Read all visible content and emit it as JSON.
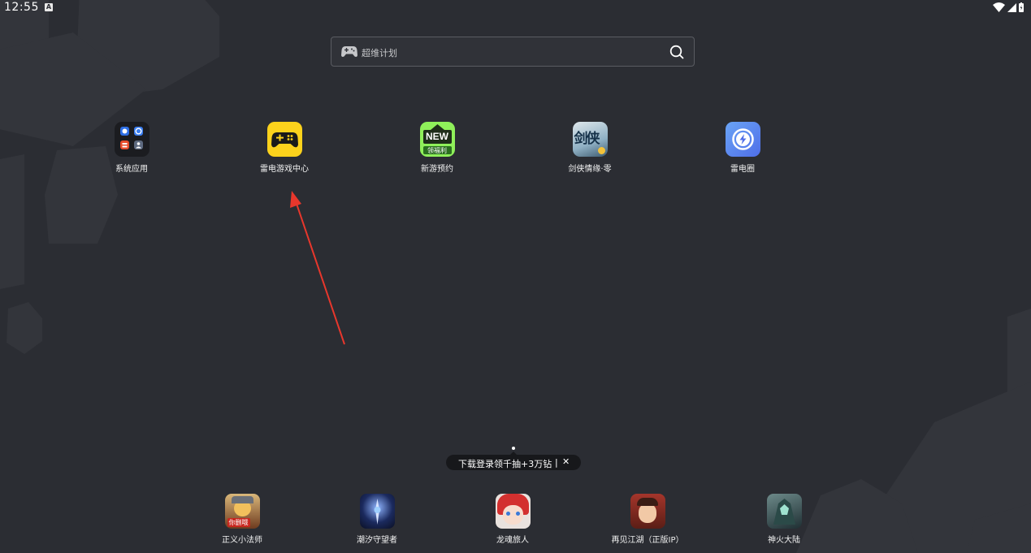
{
  "status_bar": {
    "time": "12:55",
    "notification_letter": "A"
  },
  "search": {
    "placeholder": "超维计划"
  },
  "home_apps": [
    {
      "label": "系统应用",
      "icon": "folder-icon"
    },
    {
      "label": "雷电游戏中心",
      "icon": "gamepad-icon"
    },
    {
      "label": "新游预约",
      "icon": "new-badge-icon",
      "badge_text": "NEW",
      "sub_text": "领福利"
    },
    {
      "label": "剑侠情缘·零",
      "icon": "game-icon",
      "art_text": "剑侠"
    },
    {
      "label": "雷电圈",
      "icon": "lightning-icon"
    }
  ],
  "banner": {
    "text": "下载登录领千抽+3万钻",
    "separator": "|",
    "close": "✕"
  },
  "dock_apps": [
    {
      "label": "正义小法师",
      "icon": "game-icon",
      "tag": "你删哦"
    },
    {
      "label": "潮汐守望者",
      "icon": "game-icon"
    },
    {
      "label": "龙魂旅人",
      "icon": "game-icon"
    },
    {
      "label": "再见江湖（正版IP）",
      "icon": "game-icon"
    },
    {
      "label": "神火大陆",
      "icon": "game-icon"
    }
  ],
  "colors": {
    "background": "#2b2d33",
    "hexagon": "#34363c",
    "arrow": "#e8372c",
    "game_center_yellow": "#fcd21c",
    "lightning_blue": "#5a86f2"
  }
}
